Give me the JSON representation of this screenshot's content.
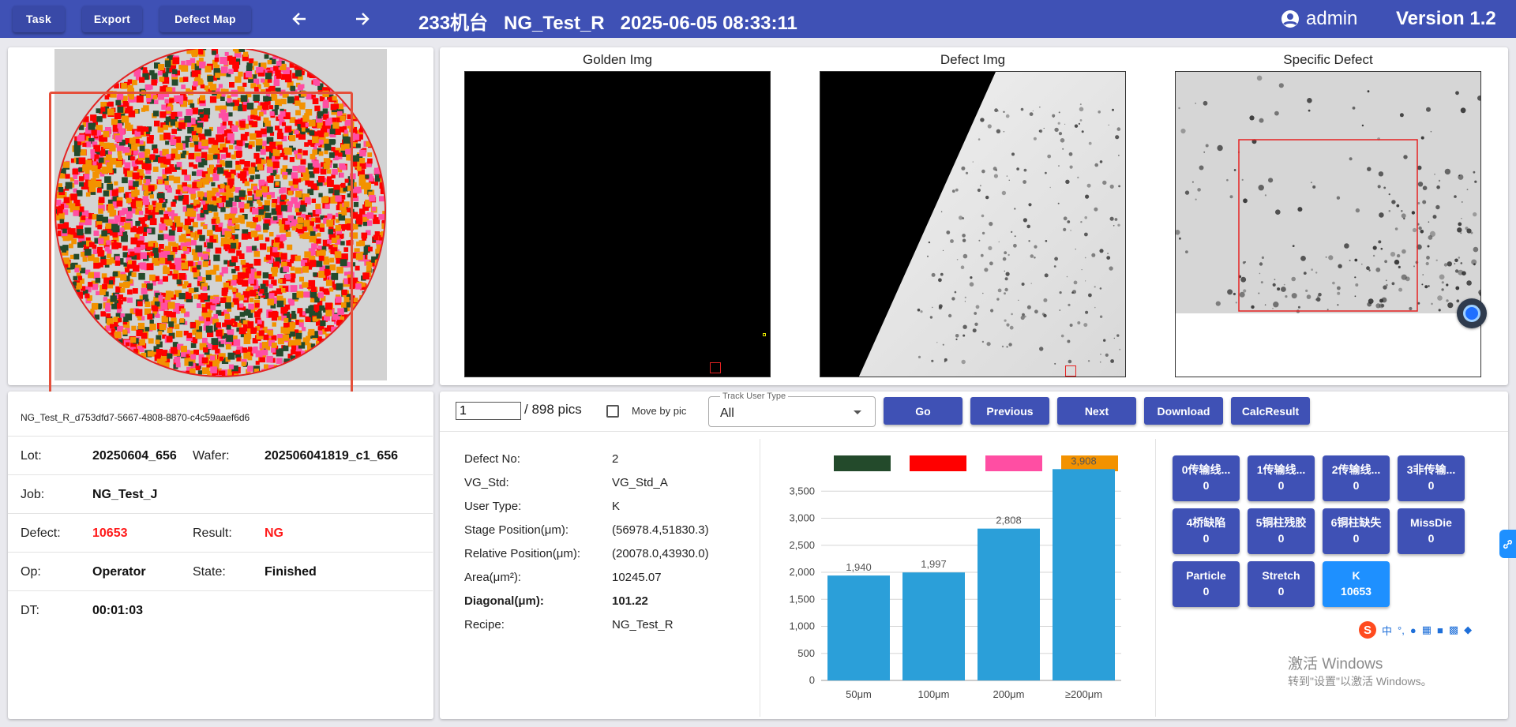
{
  "toolbar": {
    "task_label": "Task",
    "export_label": "Export",
    "defect_map_label": "Defect Map",
    "title": "233机台   NG_Test_R   2025-06-05 08:33:11",
    "user": "admin",
    "version": "Version 1.2"
  },
  "images": {
    "golden_title": "Golden Img",
    "defect_title": "Defect Img",
    "specific_title": "Specific Defect"
  },
  "info": {
    "id": "NG_Test_R_d753dfd7-5667-4808-8870-c4c59aaef6d6",
    "lot_label": "Lot:",
    "lot": "20250604_656",
    "wafer_label": "Wafer:",
    "wafer": "202506041819_c1_656",
    "job_label": "Job:",
    "job": "NG_Test_J",
    "defect_label": "Defect:",
    "defect": "10653",
    "result_label": "Result:",
    "result": "NG",
    "op_label": "Op:",
    "op": "Operator",
    "state_label": "State:",
    "state": "Finished",
    "dt_label": "DT:",
    "dt": "00:01:03"
  },
  "controls": {
    "page_value": "1",
    "total_pics": "/ 898 pics",
    "move_by_pic_label": "Move by pic",
    "track_label": "Track User Type",
    "track_value": "All",
    "go_label": "Go",
    "previous_label": "Previous",
    "next_label": "Next",
    "download_label": "Download",
    "calc_label": "CalcResult"
  },
  "defect": {
    "rows": [
      {
        "label": "Defect No:",
        "value": "2"
      },
      {
        "label": "VG_Std:",
        "value": "VG_Std_A"
      },
      {
        "label": "User Type:",
        "value": "K"
      },
      {
        "label": "Stage Position(μm):",
        "value": "(56978.4,51830.3)"
      },
      {
        "label": "Relative Position(μm):",
        "value": "(20078.0,43930.0)"
      },
      {
        "label": "Area(μm²):",
        "value": "10245.07"
      },
      {
        "label": "Diagonal(μm):",
        "value": "101.22"
      },
      {
        "label": "Recipe:",
        "value": "NG_Test_R"
      }
    ]
  },
  "chart_data": {
    "type": "bar",
    "categories": [
      "50μm",
      "100μm",
      "200μm",
      "≥200μm"
    ],
    "values": [
      1940,
      1997,
      2808,
      3908
    ],
    "value_labels": [
      "1,940",
      "1,997",
      "2,808",
      "3,908"
    ],
    "yticks": [
      "0",
      "500",
      "1,000",
      "1,500",
      "2,000",
      "2,500",
      "3,000",
      "3,500"
    ],
    "ylim": [
      0,
      4000
    ],
    "bar_color": "#2b9fd9",
    "legend_colors": [
      "#234a2b",
      "#ff0000",
      "#ff4ea3",
      "#f39200"
    ],
    "grid": true
  },
  "types": [
    {
      "name": "0传输线...",
      "count": "0"
    },
    {
      "name": "1传输线...",
      "count": "0"
    },
    {
      "name": "2传输线...",
      "count": "0"
    },
    {
      "name": "3非传输...",
      "count": "0"
    },
    {
      "name": "4桥缺陷",
      "count": "0"
    },
    {
      "name": "5铜柱残胶",
      "count": "0"
    },
    {
      "name": "6铜柱缺失",
      "count": "0"
    },
    {
      "name": "MissDie",
      "count": "0"
    },
    {
      "name": "Particle",
      "count": "0"
    },
    {
      "name": "Stretch",
      "count": "0"
    },
    {
      "name": "K",
      "count": "10653"
    }
  ],
  "windows": {
    "line1": "激活 Windows",
    "line2": "转到\"设置\"以激活 Windows。",
    "ime": "中"
  },
  "colors": {
    "primary": "#3f51b5",
    "active": "#1e90ff",
    "defect_dots": [
      "#234a2b",
      "#ff0000",
      "#ff4ea3",
      "#f39200"
    ]
  }
}
